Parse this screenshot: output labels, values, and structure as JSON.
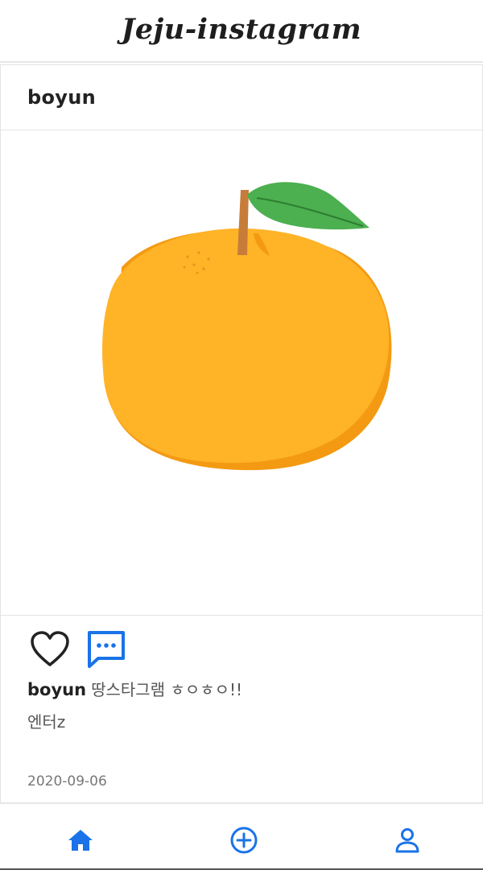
{
  "app": {
    "title": "Jeju-instagram"
  },
  "post": {
    "username": "boyun",
    "caption_user": "boyun",
    "caption_text": "땅스타그램 ㅎㅇㅎㅇ!!",
    "comment": "엔터z",
    "date": "2020-09-06"
  },
  "icons": {
    "like": "heart-icon",
    "comment": "chat-bubble-dots-icon",
    "home": "home-icon",
    "add": "plus-circle-icon",
    "profile": "person-icon"
  },
  "colors": {
    "accent": "#1a73e8",
    "orange": "#FFB327",
    "orange_shadow": "#F39A12",
    "leaf": "#4CAF50",
    "stem": "#C77C3A"
  }
}
